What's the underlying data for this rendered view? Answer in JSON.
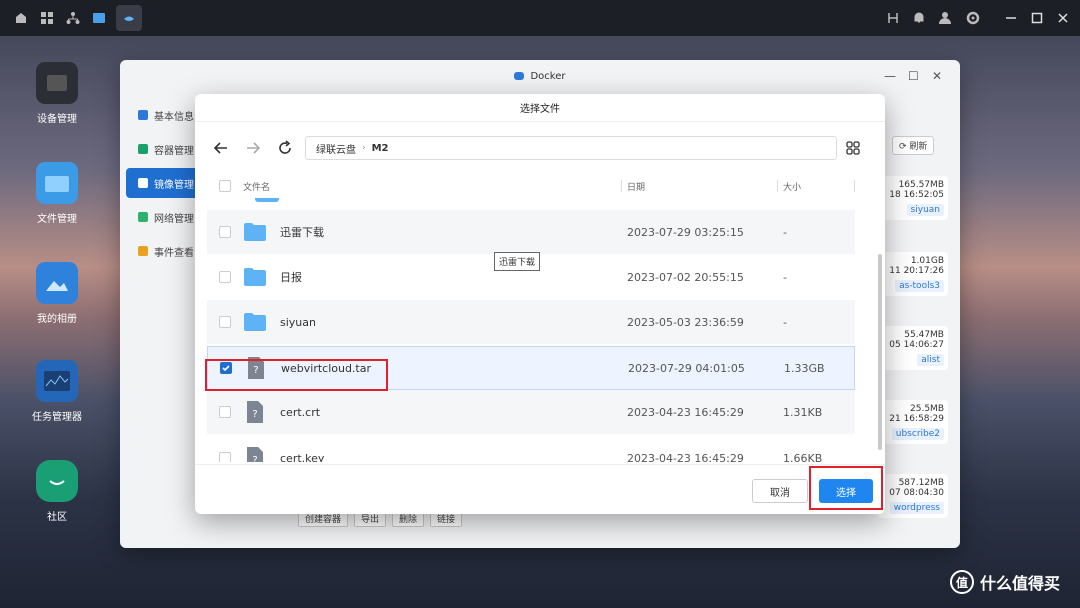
{
  "desktop": {
    "items": [
      {
        "label": "设备管理",
        "icon": "device-icon"
      },
      {
        "label": "文件管理",
        "icon": "folder-icon"
      },
      {
        "label": "我的相册",
        "icon": "photo-icon"
      },
      {
        "label": "任务管理器",
        "icon": "monitor-icon"
      },
      {
        "label": "社区",
        "icon": "chat-icon"
      }
    ]
  },
  "window": {
    "title": "Docker",
    "sidebar": [
      {
        "label": "基本信息",
        "active": false
      },
      {
        "label": "容器管理",
        "active": false
      },
      {
        "label": "镜像管理",
        "active": true
      },
      {
        "label": "网络管理",
        "active": false
      },
      {
        "label": "事件查看",
        "active": false
      }
    ],
    "refresh_label": "刷新",
    "right_cards": [
      {
        "size": "165.57MB",
        "time": "18 16:52:05",
        "tag": "siyuan"
      },
      {
        "size": "1.01GB",
        "time": "11 20:17:26",
        "tag": "as-tools3"
      },
      {
        "size": "55.47MB",
        "time": "05 14:06:27",
        "tag": "alist"
      },
      {
        "size": "25.5MB",
        "time": "21 16:58:29",
        "tag": "ubscribe2"
      },
      {
        "size": "587.12MB",
        "time": "07 08:04:30",
        "tag": "wordpress"
      }
    ],
    "bottom_buttons": [
      "创建容器",
      "导出",
      "删除",
      "链接"
    ]
  },
  "dialog": {
    "title": "选择文件",
    "breadcrumb": [
      "绿联云盘",
      "M2"
    ],
    "columns": {
      "name": "文件名",
      "date": "日期",
      "size": "大小"
    },
    "rows": [
      {
        "name": "迅雷下载",
        "date": "2023-07-29 03:25:15",
        "size": "-",
        "type": "folder",
        "checked": false
      },
      {
        "name": "日报",
        "date": "2023-07-02 20:55:15",
        "size": "-",
        "type": "folder",
        "checked": false
      },
      {
        "name": "siyuan",
        "date": "2023-05-03 23:36:59",
        "size": "-",
        "type": "folder",
        "checked": false
      },
      {
        "name": "webvirtcloud.tar",
        "date": "2023-07-29 04:01:05",
        "size": "1.33GB",
        "type": "file",
        "checked": true
      },
      {
        "name": "cert.crt",
        "date": "2023-04-23 16:45:29",
        "size": "1.31KB",
        "type": "file",
        "checked": false
      },
      {
        "name": "cert.key",
        "date": "2023-04-23 16:45:29",
        "size": "1.66KB",
        "type": "file",
        "checked": false
      }
    ],
    "tooltip": "迅雷下载",
    "cancel_label": "取消",
    "confirm_label": "选择"
  },
  "watermark": {
    "logo": "值",
    "text": "什么值得买"
  },
  "colors": {
    "accent": "#1f86f0",
    "highlight_box": "#e0202a",
    "folder": "#5db3f5"
  }
}
